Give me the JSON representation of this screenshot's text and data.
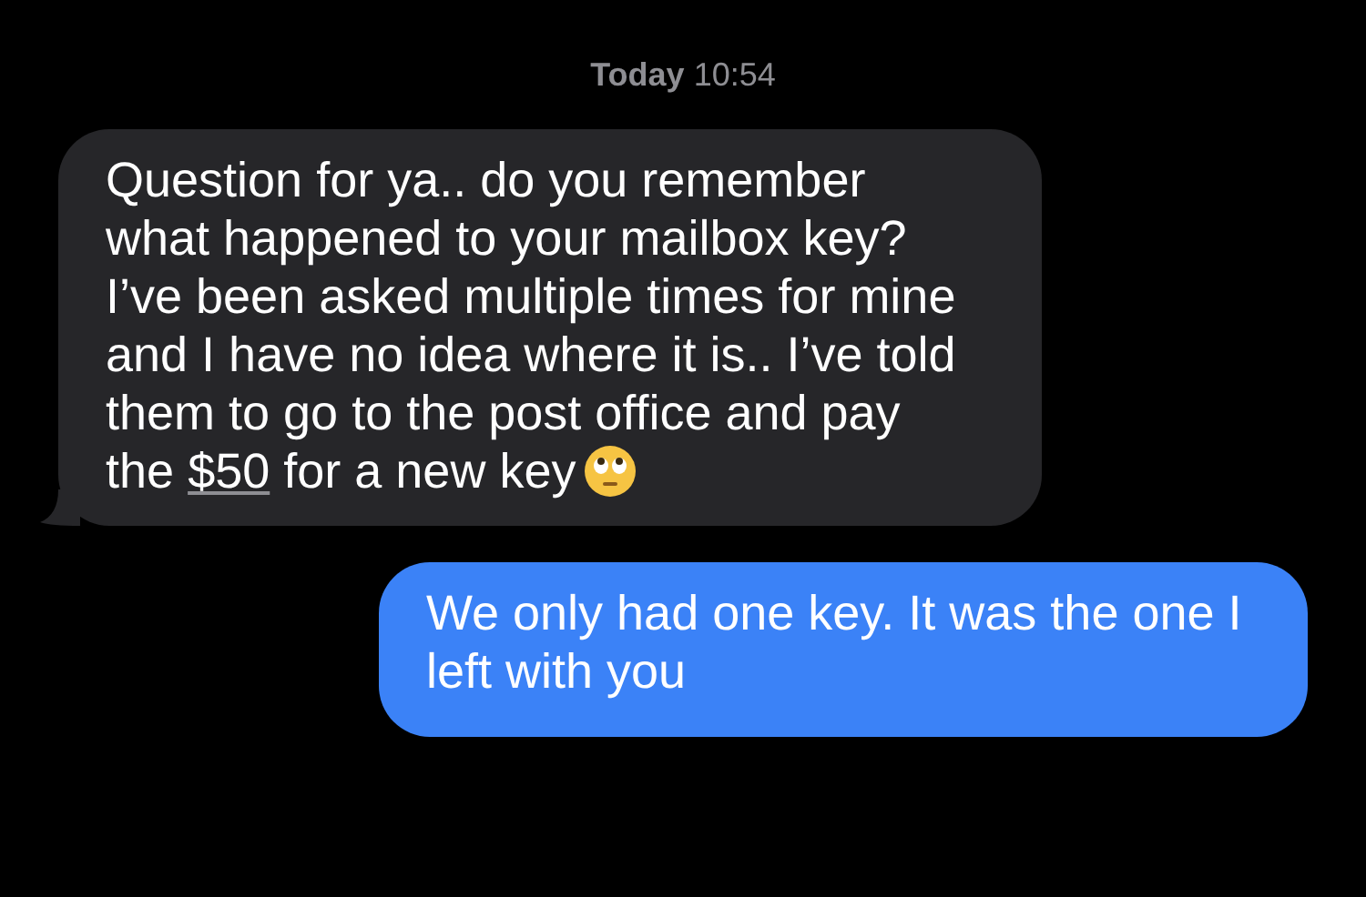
{
  "timestamp": {
    "day": "Today",
    "time": "10:54"
  },
  "messages": [
    {
      "kind": "incoming",
      "text_before": "Question for ya.. do you remember what happened to your mailbox key? I’ve been asked multiple times for mine and I have no idea where it is.. I’ve told them to go to the post office and pay the",
      "link": "$50",
      "text_after": "for a new key",
      "emoji": true
    },
    {
      "kind": "outgoing",
      "text": "We only had one key. It was the one I left with you"
    }
  ]
}
